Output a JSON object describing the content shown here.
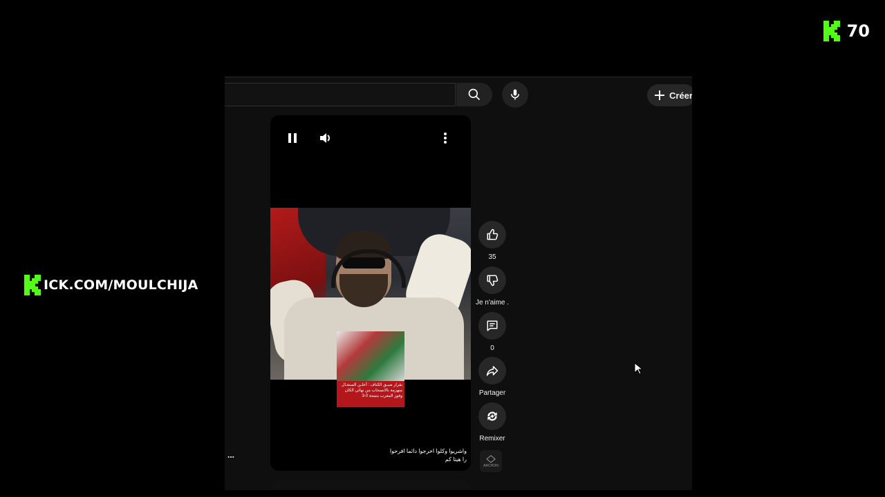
{
  "overlay": {
    "count": "70",
    "kick_url": "ICK.COM/MOULCHIJA",
    "accent_color": "#53fc18"
  },
  "topbar": {
    "search_icon": "search-icon",
    "mic_icon": "microphone-icon",
    "create_label": "Créer"
  },
  "player": {
    "pause_icon": "pause-icon",
    "volume_icon": "volume-icon",
    "more_icon": "more-vert-icon"
  },
  "news_card": {
    "caption": "بقرار صيـق الكناف : أعلـن السنغـال منهزمة بالانسحاب من نهائي الكان وفوز المغرب بنتيجة 0-3"
  },
  "actions": {
    "like_count": "35",
    "dislike_label": "Je n'aime .",
    "comment_count": "0",
    "share_label": "Partager",
    "remix_label": "Remixer"
  },
  "caption": {
    "line1": "واشريوا وكلوا اخرجوا دائما افرحوا",
    "line2": "را هيتا كم",
    "ellipsis": "..."
  },
  "sound": {
    "label": "ARCHON"
  }
}
